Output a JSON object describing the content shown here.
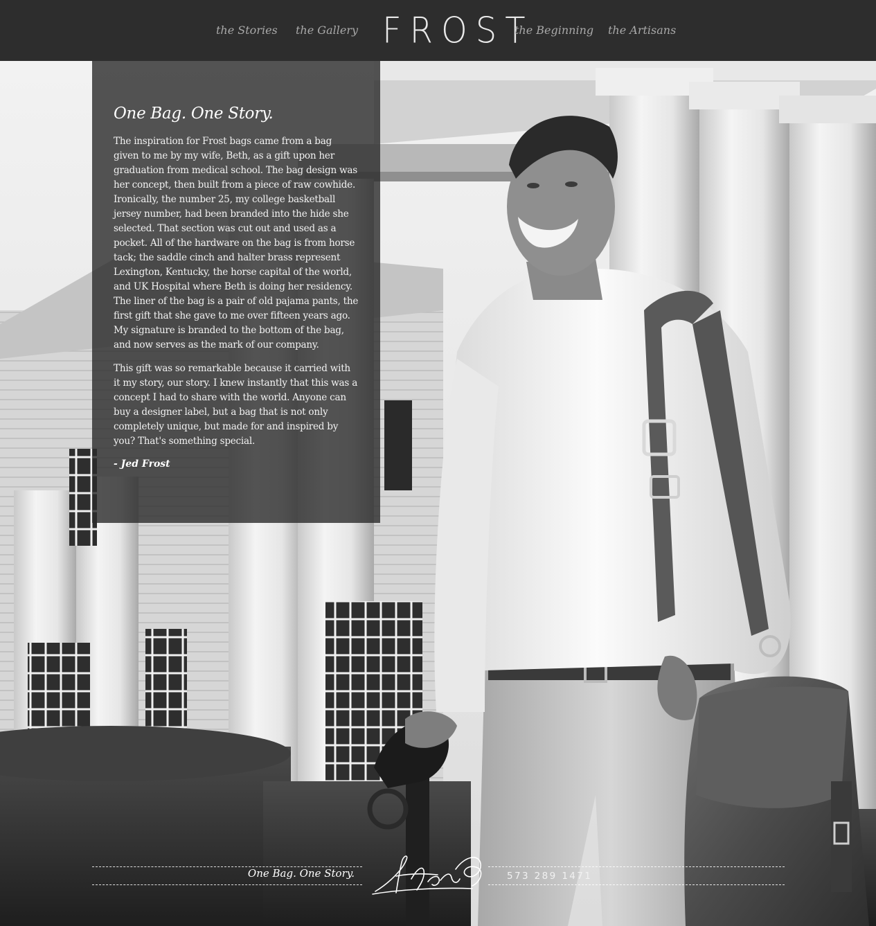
{
  "nav": {
    "stories": "the Stories",
    "gallery": "the Gallery",
    "logo": "FROST",
    "beginning": "the Beginning",
    "artisans": "the Artisans"
  },
  "story": {
    "title": "One Bag. One Story.",
    "paragraph1": "The inspiration for Frost bags came from a bag given to me by my wife, Beth, as a gift upon her graduation from medical school. The bag design was her concept, then built from a piece of raw cowhide. Ironically, the number 25, my college basketball jersey number, had been branded into the hide she selected. That section was cut out and used as a pocket. All of the hardware on the bag is from horse tack; the saddle cinch and halter brass represent Lexington, Kentucky, the horse capital of the world, and UK Hospital where Beth is doing her residency. The liner of the bag is a pair of old pajama pants, the first gift that she gave to me over fifteen years ago. My signature is branded to the bottom of the bag, and now serves as the mark of our company.",
    "paragraph2": "This gift was so remarkable because it carried with it my story, our story. I knew instantly that this was a concept I had to share with the world. Anyone can buy a designer label, but a bag that is not only completely unique, but made for and inspired by you? That's something special.",
    "signoff": "- Jed Frost"
  },
  "footer": {
    "tagline": "One Bag. One Story.",
    "phone": "573 289 1471"
  }
}
